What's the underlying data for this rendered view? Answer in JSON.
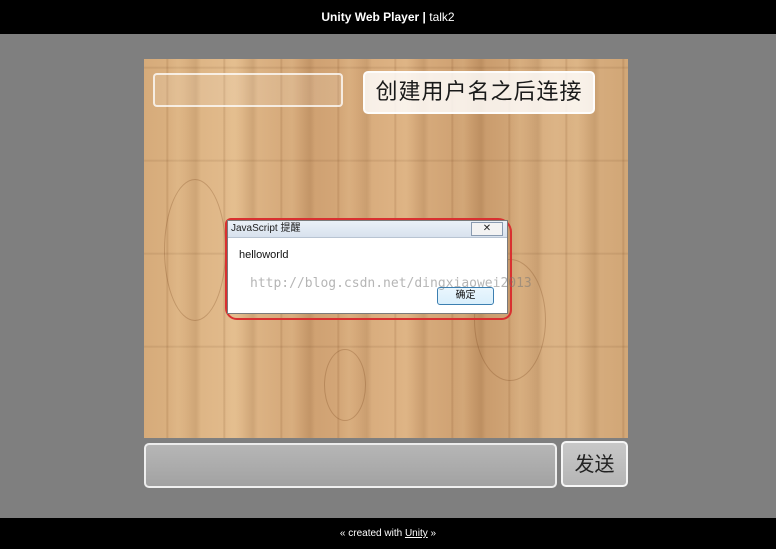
{
  "header": {
    "app_name": "Unity Web Player",
    "separator": " | ",
    "page_title": "talk2"
  },
  "game": {
    "name_input": {
      "value": ""
    },
    "connect_button": {
      "label": "创建用户名之后连接"
    },
    "message_input": {
      "value": ""
    },
    "send_button": {
      "label": "发送"
    }
  },
  "dialog": {
    "title": "JavaScript 提醒",
    "close_label": "✕",
    "message": "helloworld",
    "ok_label": "确定"
  },
  "watermark": {
    "text": "http://blog.csdn.net/dingxiaowei2013"
  },
  "footer": {
    "prefix": "« created with ",
    "link_text": "Unity",
    "suffix": " »"
  }
}
